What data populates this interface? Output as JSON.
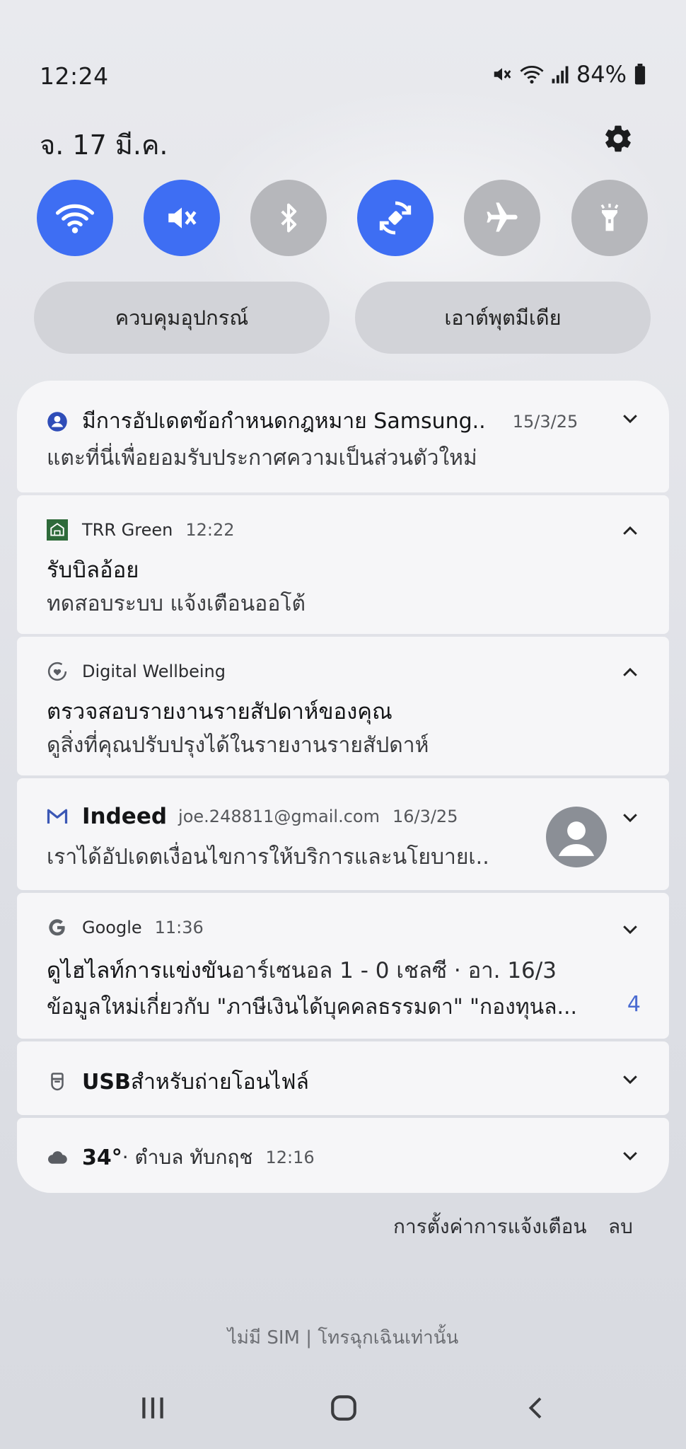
{
  "status_bar": {
    "time": "12:24",
    "battery": "84%",
    "icons": [
      "mute-icon",
      "wifi-icon",
      "signal-icon",
      "battery-icon"
    ]
  },
  "header": {
    "date": "จ. 17 มี.ค.",
    "settings_icon": "gear-icon"
  },
  "quick_toggles": [
    {
      "icon": "wifi-icon",
      "state": "on"
    },
    {
      "icon": "mute-icon",
      "state": "on"
    },
    {
      "icon": "bluetooth-icon",
      "state": "off"
    },
    {
      "icon": "auto-rotate-icon",
      "state": "on"
    },
    {
      "icon": "airplane-icon",
      "state": "off"
    },
    {
      "icon": "flashlight-icon",
      "state": "off"
    }
  ],
  "quick_buttons": {
    "device_control": "ควบคุมอุปกรณ์",
    "media_output": "เอาต์พุตมีเดีย"
  },
  "notifications": [
    {
      "icon": "account-icon",
      "title": "มีการอัปเดตข้อกำหนดกฎหมาย Samsung..",
      "time": "15/3/25",
      "body": "แตะที่นี่เพื่อยอมรับประกาศความเป็นส่วนตัวใหม่"
    },
    {
      "icon": "trr-green-icon",
      "app": "TRR Green",
      "time": "12:22",
      "title": "รับบิลอ้อย",
      "body": "ทดสอบระบบ แจ้งเตือนออโต้"
    },
    {
      "icon": "digital-wellbeing-icon",
      "app": "Digital Wellbeing",
      "title": "ตรวจสอบรายงานรายสัปดาห์ของคุณ",
      "body": "ดูสิ่งที่คุณปรับปรุงได้ในรายงานรายสัปดาห์"
    },
    {
      "icon": "gmail-icon",
      "app": "Indeed",
      "account": "joe.248811@gmail.com",
      "time": "16/3/25",
      "body": "เราได้อัปเดตเงื่อนไขการให้บริการและนโยบายเ.."
    },
    {
      "icon": "google-icon",
      "app": "Google",
      "time": "11:36",
      "title_bold": "ดูไฮไลท์การแข่งขัน",
      "title_rest": " อาร์เซนอล 1 - 0 เชลซี · อา. 16/3",
      "body": "ข้อมูลใหม่เกี่ยวกับ \"ภาษีเงินได้บุคคลธรรมดา\" \"กองทุนล...",
      "count": "4"
    },
    {
      "icon": "usb-icon",
      "title_bold": "USB",
      "title_rest": " สำหรับถ่ายโอนไฟล์"
    },
    {
      "icon": "cloud-icon",
      "title_bold": "34°",
      "title_rest": " · ตำบล ทับกฤช",
      "time": "12:16"
    }
  ],
  "footer": {
    "notification_settings": "การตั้งค่าการแจ้งเตือน",
    "clear": "ลบ",
    "sim_status": "ไม่มี SIM | โทรฉุกเฉินเท่านั้น"
  },
  "nav_bar": [
    "recents-icon",
    "home-icon",
    "back-icon"
  ]
}
